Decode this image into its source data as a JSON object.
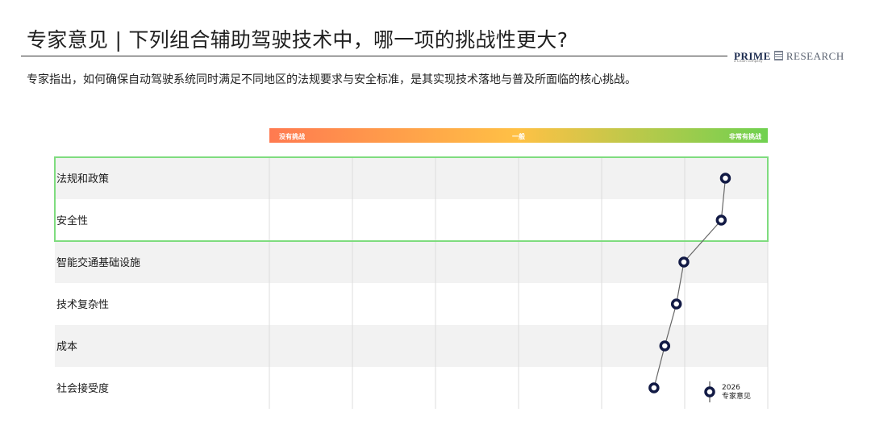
{
  "header": {
    "title": "专家意见 | 下列组合辅助驾驶技术中，哪一项的挑战性更大?",
    "subtitle": "专家指出，如何确保自动驾驶系统同时满足不同地区的法规要求与安全标准，是其实现技术落地与普及所面临的核心挑战。"
  },
  "logo": {
    "prime": "PRIME",
    "research": "RESEARCH",
    "tagline": "a Cision company"
  },
  "colors": {
    "scale_low": "#ff7a50",
    "scale_mid": "#ffc145",
    "scale_high": "#6fd150",
    "highlight_border": "#7fdc7f",
    "marker": "#121a45",
    "row_alt": "#f2f2f2",
    "connector": "#666666"
  },
  "chart_data": {
    "type": "scatter",
    "orientation": "horizontal",
    "scale_labels": [
      "没有挑战",
      "一般",
      "非常有挑战"
    ],
    "xlim": [
      0,
      6
    ],
    "grid": true,
    "categories": [
      "法规和政策",
      "安全性",
      "智能交通基础设施",
      "技术复杂性",
      "成本",
      "社会接受度"
    ],
    "series": [
      {
        "name": "2026\n专家意见",
        "values": [
          5.49,
          5.44,
          4.99,
          4.9,
          4.76,
          4.63
        ]
      }
    ],
    "highlighted_categories": [
      "法规和政策",
      "安全性"
    ],
    "legend": {
      "position": "bottom-right",
      "line1": "2026",
      "line2": "专家意见"
    }
  }
}
